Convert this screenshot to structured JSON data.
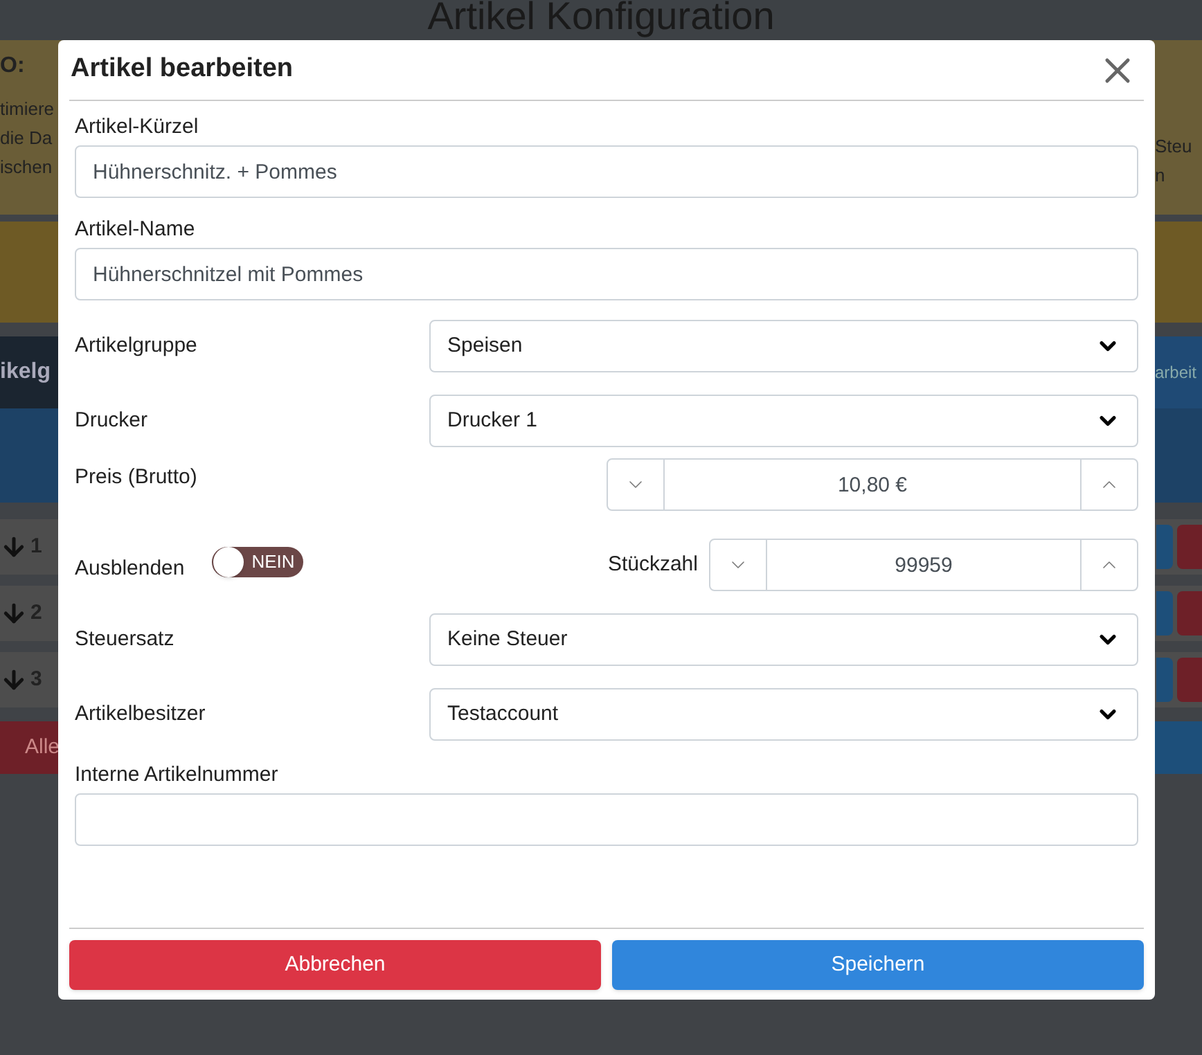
{
  "background": {
    "title": "Artikel Konfiguration",
    "info_left": [
      "O:",
      "timiere",
      "die Da",
      "ischen"
    ],
    "info_right": [
      "Steu",
      "n"
    ],
    "tab_left": "ikelg",
    "tab_right": "arbeit",
    "rows": [
      "1",
      "2",
      "3"
    ],
    "footer_button": "Alle"
  },
  "modal": {
    "title": "Artikel bearbeiten",
    "fields": [
      {
        "kind": "text",
        "label": "Artikel-Kürzel",
        "value": "Hühnerschnitz. + Pommes"
      },
      {
        "kind": "text",
        "label": "Artikel-Name",
        "value": "Hühnerschnitzel mit Pommes"
      },
      {
        "kind": "select",
        "label": "Artikelgruppe",
        "value": "Speisen"
      },
      {
        "kind": "select",
        "label": "Drucker",
        "value": "Drucker 1"
      },
      {
        "kind": "stepper",
        "label": "Preis (Brutto)",
        "value": "10,80 €"
      },
      {
        "kind": "toggle_stepper",
        "label": "Ausblenden",
        "toggle": {
          "on": false,
          "text": "NEIN"
        },
        "stepper_label": "Stückzahl",
        "value": "99959"
      },
      {
        "kind": "select",
        "label": "Steuersatz",
        "value": "Keine Steuer"
      },
      {
        "kind": "select",
        "label": "Artikelbesitzer",
        "value": "Testaccount"
      },
      {
        "kind": "text",
        "label": "Interne Artikelnummer"
      }
    ],
    "buttons": [
      {
        "kind": "cancel",
        "label": "Abbrechen"
      },
      {
        "kind": "save",
        "label": "Speichern"
      }
    ]
  }
}
